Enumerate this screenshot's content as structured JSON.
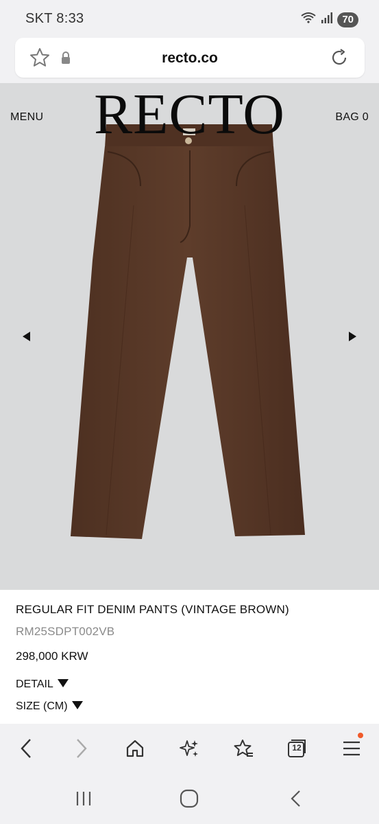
{
  "status": {
    "carrier": "SKT",
    "time": "8:33",
    "battery": "70"
  },
  "browser": {
    "url": "recto.co"
  },
  "site": {
    "menu_label": "MENU",
    "logo": "RECTO",
    "bag_label": "BAG 0"
  },
  "product": {
    "title": "REGULAR FIT DENIM PANTS (VINTAGE BROWN)",
    "sku": "RM25SDPT002VB",
    "price": "298,000 KRW",
    "detail_label": "DETAIL",
    "size_label": "SIZE (CM)",
    "color": "#5b3a28"
  },
  "toolbar": {
    "tab_count": "12"
  },
  "colors": {
    "accent_dot": "#f05a2a",
    "hero_bg": "#d9dadb"
  }
}
